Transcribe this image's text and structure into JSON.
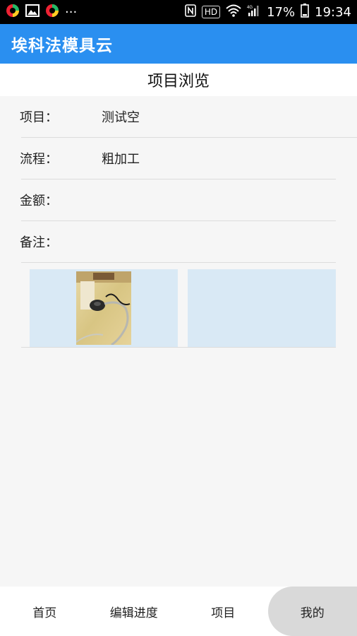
{
  "status_bar": {
    "battery": "17%",
    "time": "19:34",
    "hd": "HD",
    "network": "4G",
    "icons": [
      "app-icon",
      "image-icon",
      "app-icon",
      "more-icon",
      "nfc-icon",
      "wifi-icon",
      "signal-icon",
      "battery-icon"
    ]
  },
  "app_bar": {
    "title": "埃科法模具云"
  },
  "page": {
    "heading": "项目浏览"
  },
  "form": {
    "project_label": "项目：",
    "project_value": "测试空",
    "process_label": "流程：",
    "process_value": "粗加工",
    "amount_label": "金额：",
    "amount_value": "",
    "note_label": "备注：",
    "note_value": ""
  },
  "images": [
    "photo-thumbnail",
    "empty-slot"
  ],
  "bottom_nav": {
    "items": [
      "首页",
      "编辑进度",
      "项目",
      "我的"
    ],
    "active_index": 3
  },
  "colors": {
    "app_bar": "#2a8ff0",
    "image_slot": "#d9e9f5",
    "background": "#f6f6f6"
  }
}
